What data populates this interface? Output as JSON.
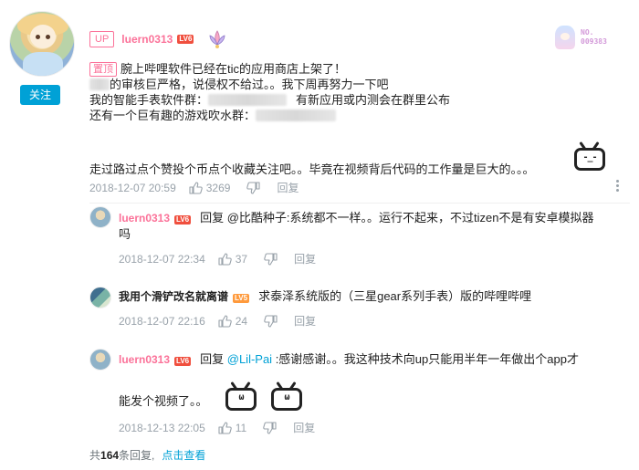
{
  "comment": {
    "follow_label": "关注",
    "up_badge": "UP",
    "username": "luern0313",
    "level": "LV6",
    "medal_icon": "lotus-medal-icon",
    "fan_badge_no": "NO.",
    "fan_badge_num": "009383",
    "pin_label": "置顶",
    "lines": {
      "l1": "腕上哔哩软件已经在tic的应用商店上架了！",
      "l2": "的审核巨严格，说侵权不给过。。我下周再努力一下吧",
      "l3a": "我的智能手表软件群：",
      "l3b": "有新应用或内测会在群里公布",
      "l4": "还有一个巨有趣的游戏吹水群：",
      "l5": "走过路过点个赞投个币点个收藏关注吧。。毕竟在视频背后代码的工作量是巨大的。。。"
    },
    "time": "2018-12-07 20:59",
    "likes": "3269",
    "reply_label": "回复"
  },
  "replies": [
    {
      "username": "luern0313",
      "level": "LV6",
      "prefix": "回复 @比酷种子:",
      "text": "系统都不一样。。运行不起来，不过tizen不是有安卓模拟器",
      "text2": "吗",
      "time": "2018-12-07 22:34",
      "likes": "37",
      "reply_label": "回复"
    },
    {
      "username": "我用个滑铲改名就离谱",
      "level": "LV5",
      "text": "求泰泽系统版的（三星gear系列手表）版的哔哩哔哩",
      "time": "2018-12-07 22:16",
      "likes": "24",
      "reply_label": "回复"
    },
    {
      "username": "luern0313",
      "level": "LV6",
      "prefix": "回复 ",
      "mention": "@Lil-Pai",
      "text": " :感谢感谢。。我这种技术向up只能用半年一年做出个app才",
      "text2": "能发个视频了。。",
      "time": "2018-12-13 22:05",
      "likes": "11",
      "reply_label": "回复"
    }
  ],
  "footer": {
    "prefix": "共",
    "count": "164",
    "suffix": "条回复,",
    "link": "点击查看"
  },
  "colors": {
    "accent_pink": "#fb7299",
    "accent_blue": "#00a1d6",
    "meta_gray": "#99a2aa"
  }
}
